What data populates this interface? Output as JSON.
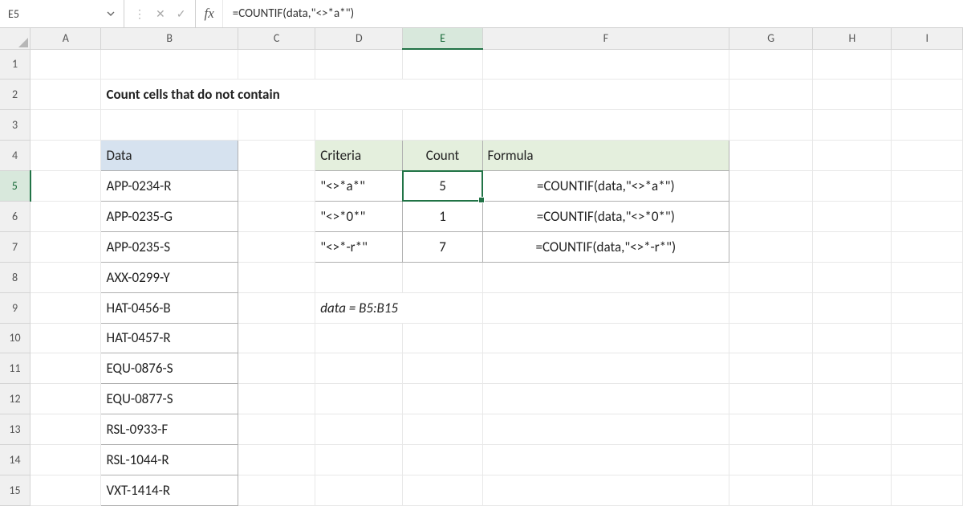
{
  "name_box": {
    "value": "E5"
  },
  "formula_bar": {
    "fx_label": "fx",
    "formula": "=COUNTIF(data,\"<>*a*\")"
  },
  "columns": [
    "A",
    "B",
    "C",
    "D",
    "E",
    "F",
    "G",
    "H",
    "I"
  ],
  "rows": [
    "1",
    "2",
    "3",
    "4",
    "5",
    "6",
    "7",
    "8",
    "9",
    "10",
    "11",
    "12",
    "13",
    "14",
    "15"
  ],
  "selected": {
    "col": "E",
    "row": "5"
  },
  "title": "Count cells that do not contain",
  "headers": {
    "data": "Data",
    "criteria": "Criteria",
    "count": "Count",
    "formula": "Formula"
  },
  "data_values": [
    "APP-0234-R",
    "APP-0235-G",
    "APP-0235-S",
    "AXX-0299-Y",
    "HAT-0456-B",
    "HAT-0457-R",
    "EQU-0876-S",
    "EQU-0877-S",
    "RSL-0933-F",
    "RSL-1044-R",
    "VXT-1414-R"
  ],
  "criteria_rows": [
    {
      "criteria": "\"<>*a*\"",
      "count": 5,
      "formula": "=COUNTIF(data,\"<>*a*\")"
    },
    {
      "criteria": "\"<>*0*\"",
      "count": 1,
      "formula": "=COUNTIF(data,\"<>*0*\")"
    },
    {
      "criteria": "\"<>*-r*\"",
      "count": 7,
      "formula": "=COUNTIF(data,\"<>*-r*\")"
    }
  ],
  "note": "data = B5:B15"
}
